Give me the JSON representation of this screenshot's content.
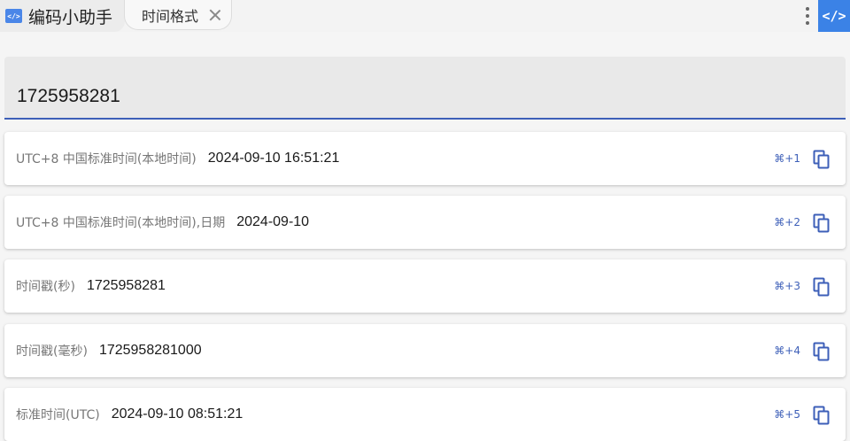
{
  "header": {
    "app_logo": "</>",
    "app_title": "编码小助手",
    "active_tab": "时间格式",
    "code_button": "</>"
  },
  "input": {
    "value": "1725958281"
  },
  "results": [
    {
      "label": "UTC+8 中国标准时间(本地时间)",
      "value": "2024-09-10 16:51:21",
      "shortcut": "⌘+1"
    },
    {
      "label": "UTC+8 中国标准时间(本地时间),日期",
      "value": "2024-09-10",
      "shortcut": "⌘+2"
    },
    {
      "label": "时间戳(秒)",
      "value": "1725958281",
      "shortcut": "⌘+3"
    },
    {
      "label": "时间戳(毫秒)",
      "value": "1725958281000",
      "shortcut": "⌘+4"
    },
    {
      "label": "标准时间(UTC)",
      "value": "2024-09-10 08:51:21",
      "shortcut": "⌘+5"
    }
  ],
  "colors": {
    "accent": "#3d5fb8",
    "brand": "#3b82e6"
  },
  "icons": [
    "close-icon",
    "more-vertical-icon",
    "code-icon",
    "copy-icon"
  ]
}
